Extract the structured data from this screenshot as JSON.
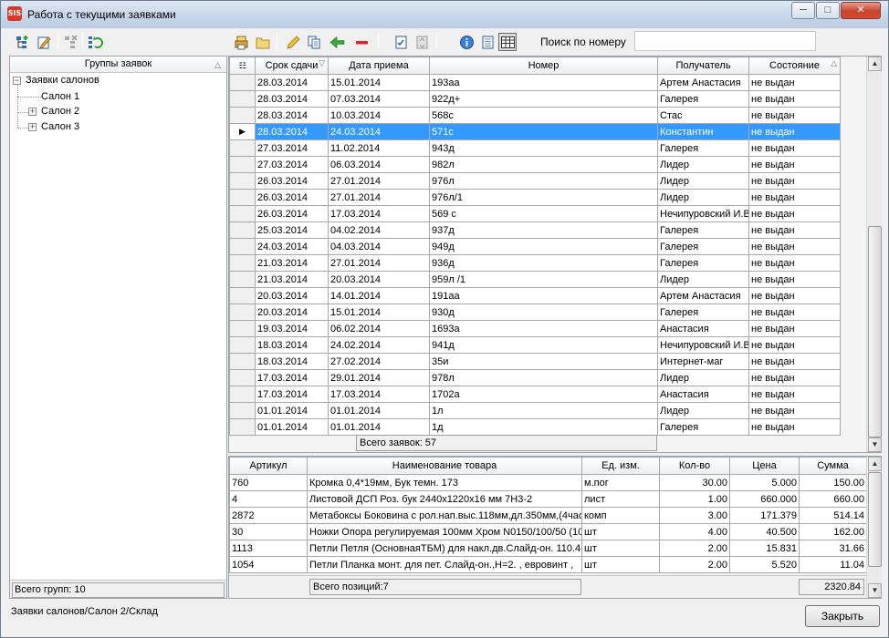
{
  "window": {
    "title": "Работа с текущими заявками",
    "icon_text": "SIS"
  },
  "search": {
    "label": "Поиск по номеру",
    "value": ""
  },
  "groups_panel": {
    "header": "Группы заявок",
    "root": "Заявки салонов",
    "children": [
      "Салон 1",
      "Салон 2",
      "Салон 3"
    ],
    "total": "Всего групп: 10"
  },
  "orders": {
    "columns": [
      "Срок сдачи",
      "Дата приема",
      "Номер",
      "Получатель",
      "Состояние"
    ],
    "rows": [
      [
        "28.03.2014",
        "15.01.2014",
        "193аа",
        "Артем Анастасия",
        "не выдан"
      ],
      [
        "28.03.2014",
        "07.03.2014",
        "922д+",
        "Галерея",
        "не выдан"
      ],
      [
        "28.03.2014",
        "10.03.2014",
        "568с",
        "Стас",
        "не выдан"
      ],
      [
        "28.03.2014",
        "24.03.2014",
        "571с",
        "Константин",
        "не выдан"
      ],
      [
        "27.03.2014",
        "11.02.2014",
        "943д",
        "Галерея",
        "не выдан"
      ],
      [
        "27.03.2014",
        "06.03.2014",
        "982л",
        "Лидер",
        "не выдан"
      ],
      [
        "26.03.2014",
        "27.01.2014",
        "976л",
        "Лидер",
        "не выдан"
      ],
      [
        "26.03.2014",
        "27.01.2014",
        "976л/1",
        "Лидер",
        "не выдан"
      ],
      [
        "26.03.2014",
        "17.03.2014",
        "569 с",
        "Нечипуровский И.В",
        "не выдан"
      ],
      [
        "25.03.2014",
        "04.02.2014",
        "937д",
        "Галерея",
        "не выдан"
      ],
      [
        "24.03.2014",
        "04.03.2014",
        "949д",
        "Галерея",
        "не выдан"
      ],
      [
        "21.03.2014",
        "27.01.2014",
        "936д",
        "Галерея",
        "не выдан"
      ],
      [
        "21.03.2014",
        "20.03.2014",
        "959л /1",
        "Лидер",
        "не выдан"
      ],
      [
        "20.03.2014",
        "14.01.2014",
        "191аа",
        "Артем Анастасия",
        "не выдан"
      ],
      [
        "20.03.2014",
        "15.01.2014",
        "930д",
        "Галерея",
        "не выдан"
      ],
      [
        "19.03.2014",
        "06.02.2014",
        "1693а",
        "Анастасия",
        "не выдан"
      ],
      [
        "18.03.2014",
        "24.02.2014",
        "941д",
        "Нечипуровский И.В",
        "не выдан"
      ],
      [
        "18.03.2014",
        "27.02.2014",
        "35и",
        "Интернет-маг",
        "не выдан"
      ],
      [
        "17.03.2014",
        "29.01.2014",
        "978л",
        "Лидер",
        "не выдан"
      ],
      [
        "17.03.2014",
        "17.03.2014",
        "1702а",
        "Анастасия",
        "не выдан"
      ],
      [
        "01.01.2014",
        "01.01.2014",
        "1л",
        "Лидер",
        "не выдан"
      ],
      [
        "01.01.2014",
        "01.01.2014",
        "1д",
        "Галерея",
        "не выдан"
      ]
    ],
    "selected_index": 3,
    "total": "Всего заявок: 57"
  },
  "items": {
    "columns": [
      "Артикул",
      "Наименование товара",
      "Ед. изм.",
      "Кол-во",
      "Цена",
      "Сумма"
    ],
    "rows": [
      [
        "760",
        "Кромка 0,4*19мм, Бук темн. 173",
        "м.пог",
        "30.00",
        "5.000",
        "150.00"
      ],
      [
        "4",
        "Листовой ДСП Роз. бук 2440x1220x16 мм 7Н3-2",
        "лист",
        "1.00",
        "660.000",
        "660.00"
      ],
      [
        "2872",
        "Метабоксы Боковина с рол.нап.выс.118мм,дл.350мм,(4час",
        "комп",
        "3.00",
        "171.379",
        "514.14"
      ],
      [
        "30",
        "Ножки Опора регулируемая 100мм Хром N0150/100/50 (10(",
        "шт",
        "4.00",
        "40.500",
        "162.00"
      ],
      [
        "1113",
        "Петли Петля (ОсновнаяТБМ) для накл.дв.Слайд-он. 110.4(",
        "шт",
        "2.00",
        "15.831",
        "31.66"
      ],
      [
        "1054",
        "Петли Планка монт. для пет. Слайд-он.,Н=2. , евровинт ,",
        "шт",
        "2.00",
        "5.520",
        "11.04"
      ]
    ],
    "total_label": "Всего позиций:7",
    "total_sum": "2320.84"
  },
  "status_path": "Заявки салонов/Салон 2/Склад",
  "close_button": "Закрыть"
}
